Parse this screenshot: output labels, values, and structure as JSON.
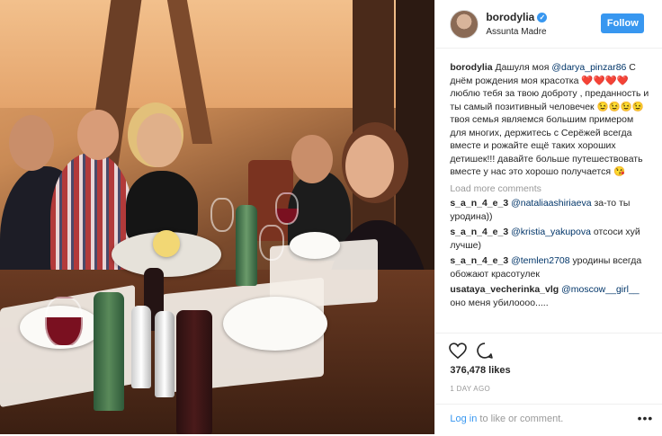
{
  "post": {
    "username": "borodylia",
    "location": "Assunta Madre",
    "follow_label": "Follow",
    "caption": {
      "user": "borodylia",
      "text_before": "Дашуля моя ",
      "mention": "@darya_pinzar86",
      "text_after": " С днём рождения моя красотка ❤️❤️❤️❤️ люблю тебя за твою доброту , преданность и ты самый позитивный человечек 😉😉😉😉 твоя семья являемся большим примером для многих, держитесь с Серёжей всегда вместе и рожайте ещё таких хороших детишек!!! давайте больше путешествовать вместе у нас это хорошо получается 😘"
    },
    "load_more": "Load more comments",
    "comments": [
      {
        "user": "s_a_n_4_e_3",
        "mention": "@nataliaashiriaeva",
        "text": " за-то ты уродина))"
      },
      {
        "user": "s_a_n_4_e_3",
        "mention": "@kristia_yakupova",
        "text": " отсоси хуй лучше)"
      },
      {
        "user": "s_a_n_4_e_3",
        "mention": "@temlen2708",
        "text": " уродины всегда обожают красотулек"
      },
      {
        "user": "usataya_vecherinka_vlg",
        "mention": "@moscow__girl__",
        "text": " оно меня убилоооо....."
      }
    ],
    "likes": "376,478 likes",
    "age": "1 DAY AGO",
    "login_link": "Log in",
    "login_rest": " to like or comment.",
    "icons": {
      "like": "heart-icon",
      "comment": "comment-icon",
      "more": "more-options-icon",
      "verified": "verified-badge-icon"
    },
    "colors": {
      "accent": "#3897f0",
      "mention": "#003569",
      "muted": "#999999"
    }
  }
}
